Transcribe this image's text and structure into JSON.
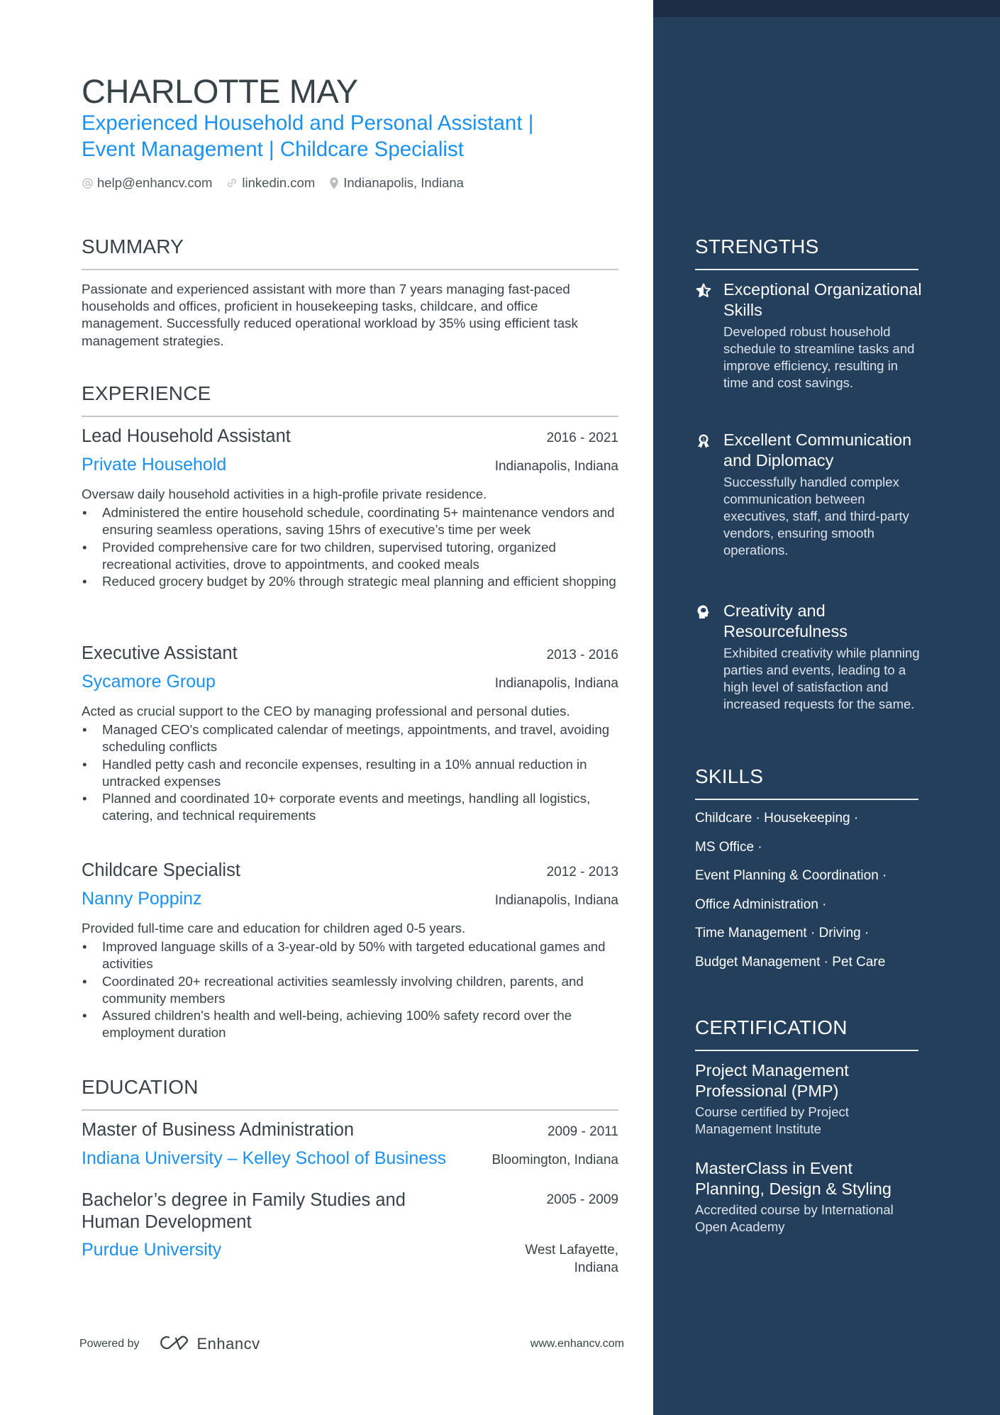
{
  "header": {
    "name": "CHARLOTTE MAY",
    "headline_line1": "Experienced Household and Personal Assistant |",
    "headline_line2": "Event Management | Childcare Specialist",
    "contacts": [
      {
        "icon": "at-icon",
        "text": "help@enhancv.com"
      },
      {
        "icon": "link-icon",
        "text": "linkedin.com"
      },
      {
        "icon": "location-pin-icon",
        "text": "Indianapolis, Indiana"
      }
    ]
  },
  "summary": {
    "title": "SUMMARY",
    "text": "Passionate and experienced assistant with more than 7 years managing fast-paced households and offices, proficient in housekeeping tasks, childcare, and office management. Successfully reduced operational workload by 35% using efficient task management strategies."
  },
  "experience": {
    "title": "EXPERIENCE",
    "items": [
      {
        "role": "Lead Household Assistant",
        "dates": "2016 - 2021",
        "company": "Private Household",
        "location": "Indianapolis, Indiana",
        "description": "Oversaw daily household activities in a high-profile private residence.",
        "bullets": [
          "Administered the entire household schedule, coordinating 5+ maintenance vendors and ensuring seamless operations, saving 15hrs of executive’s time per week",
          "Provided comprehensive care for two children, supervised tutoring, organized recreational activities, drove to appointments, and cooked meals",
          "Reduced grocery budget by 20% through strategic meal planning and efficient shopping"
        ]
      },
      {
        "role": "Executive Assistant",
        "dates": "2013 - 2016",
        "company": "Sycamore Group",
        "location": "Indianapolis, Indiana",
        "description": "Acted as crucial support to the CEO by managing professional and personal duties.",
        "bullets": [
          "Managed CEO's complicated calendar of meetings, appointments, and travel, avoiding scheduling conflicts",
          "Handled petty cash and reconcile expenses, resulting in a 10% annual reduction in untracked expenses",
          "Planned and coordinated 10+ corporate events and meetings, handling all logistics, catering, and technical requirements"
        ]
      },
      {
        "role": "Childcare Specialist",
        "dates": "2012 - 2013",
        "company": "Nanny Poppinz",
        "location": "Indianapolis, Indiana",
        "description": "Provided full-time care and education for children aged 0-5 years.",
        "bullets": [
          "Improved language skills of a 3-year-old by 50% with targeted educational games and activities",
          "Coordinated 20+ recreational activities seamlessly involving children, parents, and community members",
          "Assured children's health and well-being, achieving 100% safety record over the employment duration"
        ]
      }
    ]
  },
  "education": {
    "title": "EDUCATION",
    "items": [
      {
        "degree": "Master of Business Administration",
        "dates": "2009 - 2011",
        "school": "Indiana University – Kelley School of Business",
        "location": "Bloomington, Indiana"
      },
      {
        "degree_line1": "Bachelor’s degree in Family Studies and",
        "degree_line2": "Human Development",
        "dates": "2005 - 2009",
        "school": "Purdue University",
        "location_line1": "West Lafayette,",
        "location_line2": "Indiana"
      }
    ]
  },
  "footer": {
    "powered_by": "Powered by",
    "brand": "Enhancv",
    "website": "www.enhancv.com"
  },
  "strengths": {
    "title": "STRENGTHS",
    "items": [
      {
        "icon": "star-half-icon",
        "title": "Exceptional Organizational Skills",
        "description": "Developed robust household schedule to streamline tasks and improve efficiency, resulting in time and cost savings."
      },
      {
        "icon": "award-ribbon-icon",
        "title": "Excellent Communication and Diplomacy",
        "description": "Successfully handled complex communication between executives, staff, and third-party vendors, ensuring smooth operations."
      },
      {
        "icon": "head-brain-icon",
        "title": "Creativity and Resourcefulness",
        "description": "Exhibited creativity while planning parties and events, leading to a high level of satisfaction and increased requests for the same."
      }
    ]
  },
  "skills": {
    "title": "SKILLS",
    "lines": [
      "Childcare · Housekeeping ·",
      "MS Office ·",
      "Event Planning & Coordination ·",
      "Office Administration ·",
      "Time Management · Driving ·",
      "Budget Management · Pet Care"
    ]
  },
  "certification": {
    "title": "CERTIFICATION",
    "items": [
      {
        "title": "Project Management Professional (PMP)",
        "description": "Course certified by Project Management Institute"
      },
      {
        "title": "MasterClass in Event Planning, Design & Styling",
        "description": "Accredited course by International Open Academy"
      }
    ]
  },
  "colors": {
    "accent": "#1a91f0",
    "text": "#384347",
    "sidebar": "#233f5c",
    "sidebar_top": "#1a2d44"
  }
}
